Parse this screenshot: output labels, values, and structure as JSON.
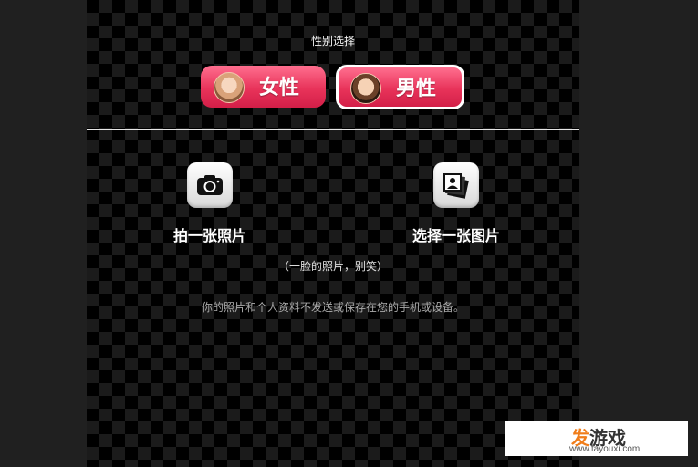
{
  "gender_section": {
    "title": "性别选择",
    "female_label": "女性",
    "male_label": "男性",
    "selected": "男性"
  },
  "photo_actions": {
    "take_photo_label": "拍一张照片",
    "choose_photo_label": "选择一张图片"
  },
  "hint_text": "（一脸的照片，别笑）",
  "privacy_text": "你的照片和个人资料不发送或保存在您的手机或设备。",
  "watermark": {
    "brand_highlight": "发",
    "brand_rest": "游戏",
    "url": "www.fayouxi.com"
  },
  "colors": {
    "button_gradient_top": "#ff6f8f",
    "button_gradient_bottom": "#d31f48",
    "selected_border": "#ffffff",
    "brand_orange": "#f07d1a"
  },
  "icons": {
    "camera": "camera-icon",
    "gallery": "photo-gallery-icon"
  }
}
